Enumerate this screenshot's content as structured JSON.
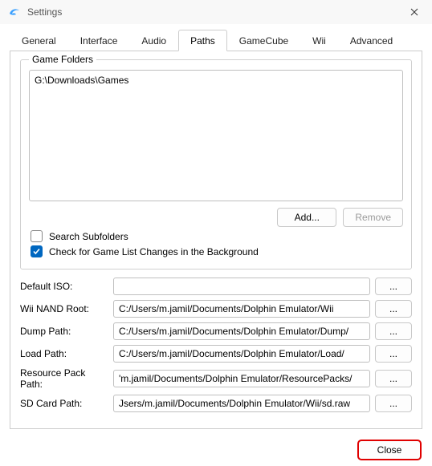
{
  "window": {
    "title": "Settings"
  },
  "tabs": {
    "general": "General",
    "interface": "Interface",
    "audio": "Audio",
    "paths": "Paths",
    "gamecube": "GameCube",
    "wii": "Wii",
    "advanced": "Advanced"
  },
  "gameFolders": {
    "legend": "Game Folders",
    "items": [
      "G:\\Downloads\\Games"
    ],
    "addLabel": "Add...",
    "removeLabel": "Remove"
  },
  "options": {
    "searchSubfolders": {
      "label": "Search Subfolders",
      "checked": false
    },
    "backgroundCheck": {
      "label": "Check for Game List Changes in the Background",
      "checked": true
    }
  },
  "paths": {
    "defaultISO": {
      "label": "Default ISO:",
      "value": ""
    },
    "wiiNandRoot": {
      "label": "Wii NAND Root:",
      "value": "C:/Users/m.jamil/Documents/Dolphin Emulator/Wii"
    },
    "dumpPath": {
      "label": "Dump Path:",
      "value": "C:/Users/m.jamil/Documents/Dolphin Emulator/Dump/"
    },
    "loadPath": {
      "label": "Load Path:",
      "value": "C:/Users/m.jamil/Documents/Dolphin Emulator/Load/"
    },
    "resourcePack": {
      "label": "Resource Pack Path:",
      "value": "'m.jamil/Documents/Dolphin Emulator/ResourcePacks/"
    },
    "sdCard": {
      "label": "SD Card Path:",
      "value": "Jsers/m.jamil/Documents/Dolphin Emulator/Wii/sd.raw"
    },
    "browseLabel": "..."
  },
  "footer": {
    "closeLabel": "Close"
  }
}
